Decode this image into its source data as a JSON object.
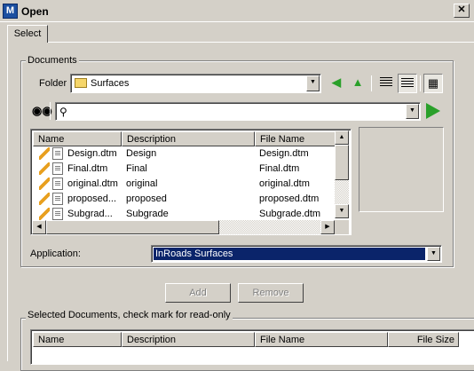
{
  "window": {
    "title": "Open",
    "icon_text": "M",
    "close_label": "✕"
  },
  "tabs": [
    {
      "label": "Select"
    }
  ],
  "documents": {
    "group_label": "Documents",
    "folder_label": "Folder",
    "folder_value": "Surfaces",
    "columns": [
      "Name",
      "Description",
      "File Name"
    ],
    "rows": [
      {
        "name": "Design.dtm",
        "description": "Design",
        "file_name": "Design.dtm"
      },
      {
        "name": "Final.dtm",
        "description": "Final",
        "file_name": "Final.dtm"
      },
      {
        "name": "original.dtm",
        "description": "original",
        "file_name": "original.dtm"
      },
      {
        "name": "proposed...",
        "description": "proposed",
        "file_name": "proposed.dtm"
      },
      {
        "name": "Subgrad...",
        "description": "Subgrade",
        "file_name": "Subgrade.dtm"
      }
    ],
    "application_label": "Application:",
    "application_value": "InRoads Surfaces"
  },
  "buttons": {
    "add": "Add",
    "remove": "Remove"
  },
  "selected": {
    "group_label": "Selected Documents, check mark for read-only",
    "columns": [
      "Name",
      "Description",
      "File Name",
      "File Size"
    ]
  },
  "icons": {
    "back": "green-left-arrow-icon",
    "up": "folder-up-icon",
    "list_view": "list-view-icon",
    "details_view": "details-view-icon",
    "preview": "preview-icon",
    "search": "binoculars-icon",
    "go": "green-play-arrow-icon"
  },
  "colors": {
    "selection": "#0a246a",
    "go_arrow": "#2aa02a",
    "window_bg": "#d4d0c8"
  }
}
